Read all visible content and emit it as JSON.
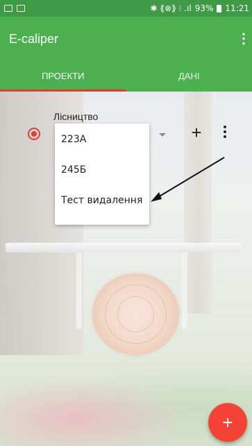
{
  "status_bar": {
    "icons_right": "✱ ⟪⊗⟫ ⁝ .ıl",
    "battery": "93%",
    "time": "11:21"
  },
  "app_bar": {
    "title": "E-caliper",
    "overflow_icon": "⋮"
  },
  "tabs": [
    {
      "label": "ПРОЕКТИ",
      "active": true
    },
    {
      "label": "ДАНІ",
      "active": false
    }
  ],
  "form": {
    "label": "Лісництво",
    "add_icon": "+"
  },
  "dropdown": {
    "items": [
      "223А",
      "245Б",
      "Тест видалення"
    ]
  },
  "fab": {
    "icon": "+"
  },
  "colors": {
    "status_bar": "#3f9a45",
    "primary": "#4caf50",
    "accent": "#f44336",
    "tab_indicator": "#e53935"
  }
}
